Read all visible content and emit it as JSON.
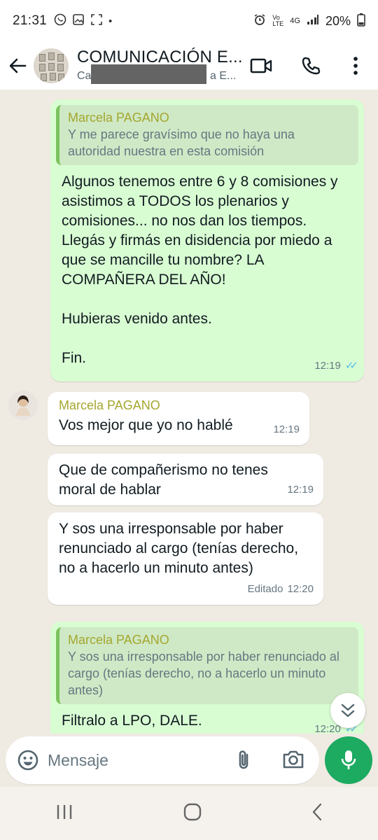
{
  "status_bar": {
    "time": "21:31",
    "network": "4G",
    "volte": "Vo LTE",
    "battery": "20%"
  },
  "header": {
    "title": "COMUNICACIÓN E...",
    "subtitle_start": "Ca",
    "subtitle_end": "a E..."
  },
  "messages": [
    {
      "quote_name": "Marcela PAGANO",
      "quote_text": "Y me parece gravísimo que no haya una autoridad nuestra en esta comisión",
      "text": "Algunos tenemos entre 6 y 8 comisiones y asistimos a TODOS los plenarios y comisiones... no nos dan los tiempos. Llegás y firmás en disidencia por miedo a que se mancille tu nombre? LA COMPAÑERA DEL AÑO!\n\nHubieras venido antes.\n\nFin.",
      "time": "12:19"
    },
    {
      "sender": "Marcela PAGANO",
      "text": "Vos mejor que yo no hablé",
      "time": "12:19"
    },
    {
      "text": "Que de compañerismo no tenes moral de hablar",
      "time": "12:19"
    },
    {
      "text": "Y sos una irresponsable por haber renunciado al cargo (tenías derecho, no a hacerlo un minuto antes)",
      "edited": "Editado",
      "time": "12:20"
    },
    {
      "quote_name": "Marcela PAGANO",
      "quote_text": "Y sos una irresponsable por haber renunciado al cargo (tenías derecho, no a hacerlo un minuto antes)",
      "text": "Filtralo a LPO, DALE.",
      "time": "12:20"
    }
  ],
  "input": {
    "placeholder": "Mensaje"
  },
  "colors": {
    "outgoing_bubble": "#d9fdd3",
    "incoming_bubble": "#ffffff",
    "accent_green": "#1daa61",
    "sender_name": "#a4a62e",
    "read_ticks": "#53bdeb"
  },
  "icons": [
    "back-arrow-icon",
    "video-call-icon",
    "phone-icon",
    "more-vert-icon",
    "emoji-icon",
    "attach-icon",
    "camera-icon",
    "mic-icon",
    "scroll-down-icon",
    "nav-recents-icon",
    "nav-home-icon",
    "nav-back-icon"
  ]
}
